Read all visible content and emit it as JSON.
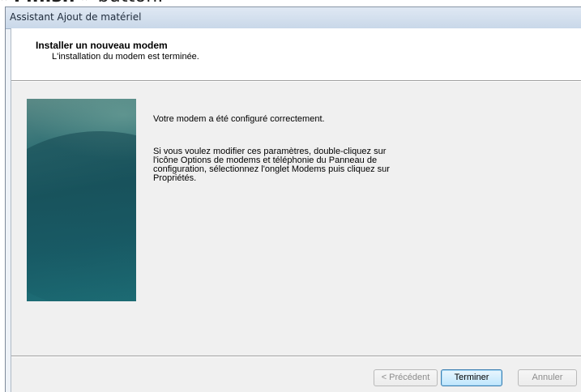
{
  "caption": {
    "prefix": "« ",
    "bold": "Finish",
    "suffix": " » button."
  },
  "window": {
    "title": "Assistant Ajout de matériel"
  },
  "header": {
    "title": "Installer un nouveau modem",
    "subtitle": "L'installation du modem est terminée."
  },
  "content": {
    "line1": "Votre modem a été configuré correctement.",
    "line2": "Si vous voulez modifier ces paramètres, double-cliquez sur l'icône Options de modems et téléphonie du Panneau de configuration, sélectionnez l'onglet Modems puis cliquez sur Propriétés."
  },
  "buttons": {
    "previous": "< Précédent",
    "finish": "Terminer",
    "cancel": "Annuler"
  },
  "colors": {
    "banner": "#1b5a63",
    "default_button_border": "#3c7fb1"
  }
}
